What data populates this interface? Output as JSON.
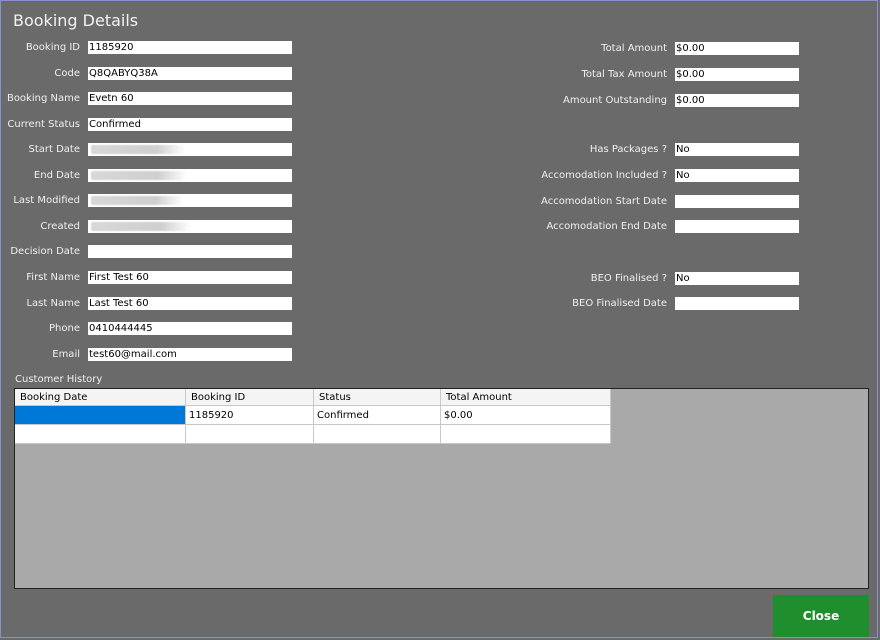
{
  "window": {
    "title": "Booking Details"
  },
  "left_fields": [
    {
      "label": "Booking ID",
      "value": "1185920"
    },
    {
      "label": "Code",
      "value": "Q8QABYQ38A"
    },
    {
      "label": "Booking Name",
      "value": "Evetn 60"
    },
    {
      "label": "Current Status",
      "value": "Confirmed"
    },
    {
      "label": "Start Date",
      "value": ""
    },
    {
      "label": "End Date",
      "value": ""
    },
    {
      "label": "Last Modified",
      "value": ""
    },
    {
      "label": "Created",
      "value": ""
    },
    {
      "label": "Decision Date",
      "value": ""
    },
    {
      "label": "First Name",
      "value": "First Test 60"
    },
    {
      "label": "Last Name",
      "value": "Last Test 60"
    },
    {
      "label": "Phone",
      "value": "0410444445"
    },
    {
      "label": "Email",
      "value": "test60@mail.com"
    }
  ],
  "right_fields": [
    {
      "label": "Total Amount",
      "value": "$0.00"
    },
    {
      "label": "Total Tax Amount",
      "value": "$0.00"
    },
    {
      "label": "Amount Outstanding",
      "value": "$0.00"
    },
    {
      "label": "Has Packages ?",
      "value": "No"
    },
    {
      "label": "Accomodation Included ?",
      "value": "No"
    },
    {
      "label": "Accomodation Start Date",
      "value": ""
    },
    {
      "label": "Accomodation End Date",
      "value": ""
    },
    {
      "label": "BEO Finalised ?",
      "value": "No"
    },
    {
      "label": "BEO Finalised Date",
      "value": ""
    }
  ],
  "customer_history": {
    "label": "Customer History",
    "columns": [
      "Booking Date",
      "Booking ID",
      "Status",
      "Total Amount"
    ],
    "rows": [
      [
        "",
        "1185920",
        "Confirmed",
        "$0.00"
      ],
      [
        "",
        "",
        "",
        ""
      ]
    ]
  },
  "actions": {
    "close_label": "Close"
  },
  "colors": {
    "close_button": "#1f8f2d",
    "selection": "#0078d7",
    "background": "#6a6a6a"
  }
}
